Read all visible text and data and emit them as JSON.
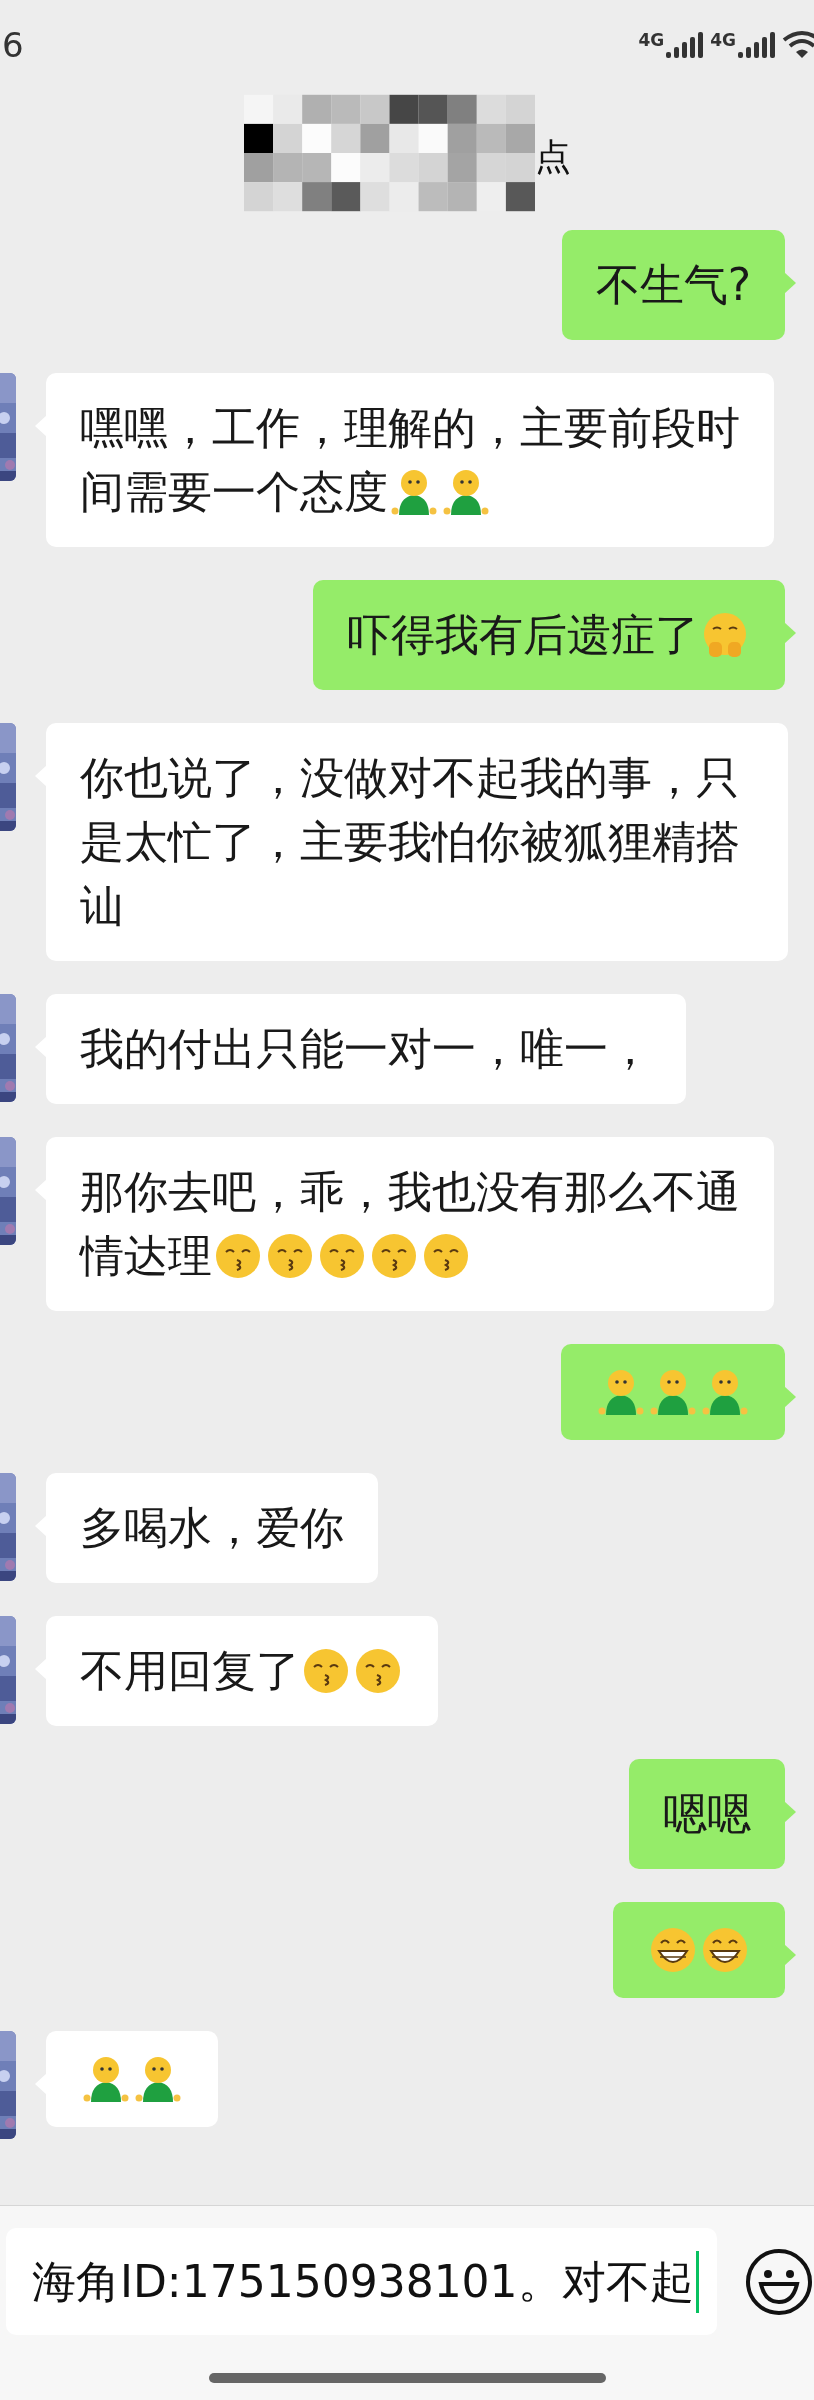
{
  "status_bar": {
    "time": "6",
    "networks": [
      "4G",
      "4G"
    ]
  },
  "header": {
    "title": "点"
  },
  "messages": [
    {
      "kind": "sent",
      "lines": [
        [
          {
            "kind": "text",
            "text": "不生气?"
          }
        ]
      ]
    },
    {
      "kind": "received",
      "lines": [
        [
          {
            "kind": "text",
            "text": "嘿嘿，工作，理解的，主要前段时"
          }
        ],
        [
          {
            "kind": "text",
            "text": "间需要一个态度"
          },
          {
            "kind": "figure"
          },
          {
            "kind": "figure"
          }
        ]
      ]
    },
    {
      "kind": "sent",
      "lines": [
        [
          {
            "kind": "text",
            "text": "吓得我有后遗症了"
          },
          {
            "kind": "shy"
          }
        ]
      ]
    },
    {
      "kind": "received",
      "lines": [
        [
          {
            "kind": "text",
            "text": "你也说了，没做对不起我的事，只是太忙了，主要我怕你被狐狸精搭讪"
          }
        ]
      ]
    },
    {
      "kind": "received",
      "lines": [
        [
          {
            "kind": "text",
            "text": "我的付出只能一对一，唯一，"
          }
        ]
      ]
    },
    {
      "kind": "received",
      "lines": [
        [
          {
            "kind": "text",
            "text": "那你去吧，乖，我也没有那么不通"
          }
        ],
        [
          {
            "kind": "text",
            "text": "情达理"
          },
          {
            "kind": "kiss"
          },
          {
            "kind": "kiss"
          },
          {
            "kind": "kiss"
          },
          {
            "kind": "kiss"
          },
          {
            "kind": "kiss"
          }
        ]
      ]
    },
    {
      "kind": "sent",
      "lines": [
        [
          {
            "kind": "figure"
          },
          {
            "kind": "figure"
          },
          {
            "kind": "figure"
          }
        ]
      ]
    },
    {
      "kind": "received",
      "lines": [
        [
          {
            "kind": "text",
            "text": "多喝水，爱你"
          }
        ]
      ]
    },
    {
      "kind": "received",
      "lines": [
        [
          {
            "kind": "text",
            "text": "不用回复了"
          },
          {
            "kind": "kiss"
          },
          {
            "kind": "kiss"
          }
        ]
      ]
    },
    {
      "kind": "sent",
      "lines": [
        [
          {
            "kind": "text",
            "text": "嗯嗯"
          }
        ]
      ]
    },
    {
      "kind": "sent",
      "lines": [
        [
          {
            "kind": "grin"
          },
          {
            "kind": "grin"
          }
        ]
      ]
    },
    {
      "kind": "received",
      "lines": [
        [
          {
            "kind": "figure"
          },
          {
            "kind": "figure"
          }
        ]
      ]
    }
  ],
  "input": {
    "value": "海角ID:175150938101。对不起"
  }
}
